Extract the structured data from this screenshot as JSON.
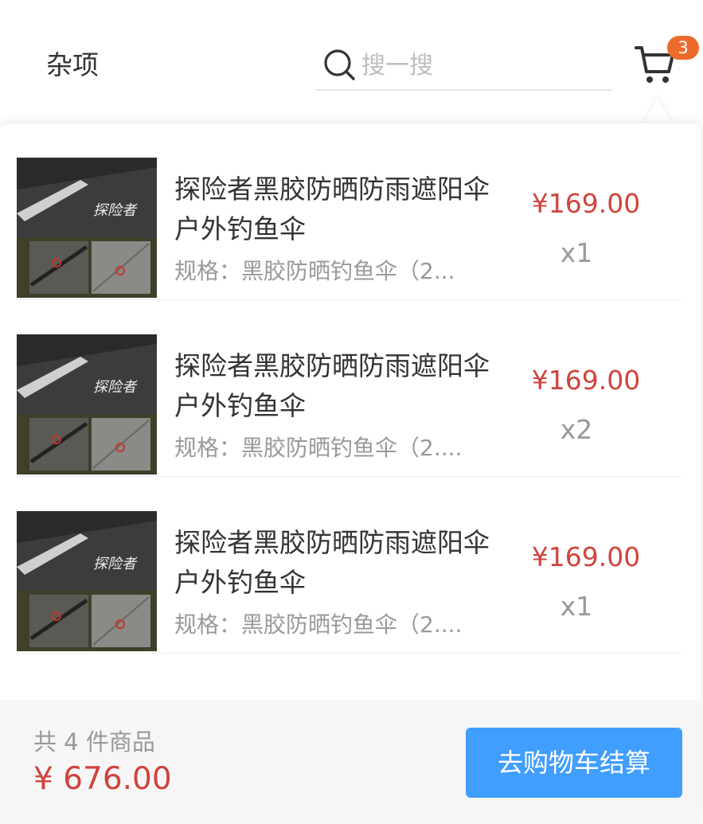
{
  "header": {
    "category": "杂项",
    "search_placeholder": "搜一搜",
    "cart_count": "3"
  },
  "items": [
    {
      "title": "探险者黑胶防晒防雨遮阳伞户外钓鱼伞",
      "spec": "规格：黑胶防晒钓鱼伞（2...",
      "price": "¥169.00",
      "qty": "x1",
      "image_text": "探险者"
    },
    {
      "title": "探险者黑胶防晒防雨遮阳伞户外钓鱼伞",
      "spec": "规格：黑胶防晒钓鱼伞（2....",
      "price": "¥169.00",
      "qty": "x2",
      "image_text": "探险者"
    },
    {
      "title": "探险者黑胶防晒防雨遮阳伞户外钓鱼伞",
      "spec": "规格：黑胶防晒钓鱼伞（2....",
      "price": "¥169.00",
      "qty": "x1",
      "image_text": "探险者"
    }
  ],
  "footer": {
    "count_text": "共 4 件商品",
    "total": "¥ 676.00",
    "checkout_label": "去购物车结算"
  },
  "colors": {
    "price": "#d0433d",
    "badge": "#ec6a2b",
    "button": "#409eff"
  },
  "icons": {
    "search": "search-icon",
    "cart": "cart-icon"
  }
}
